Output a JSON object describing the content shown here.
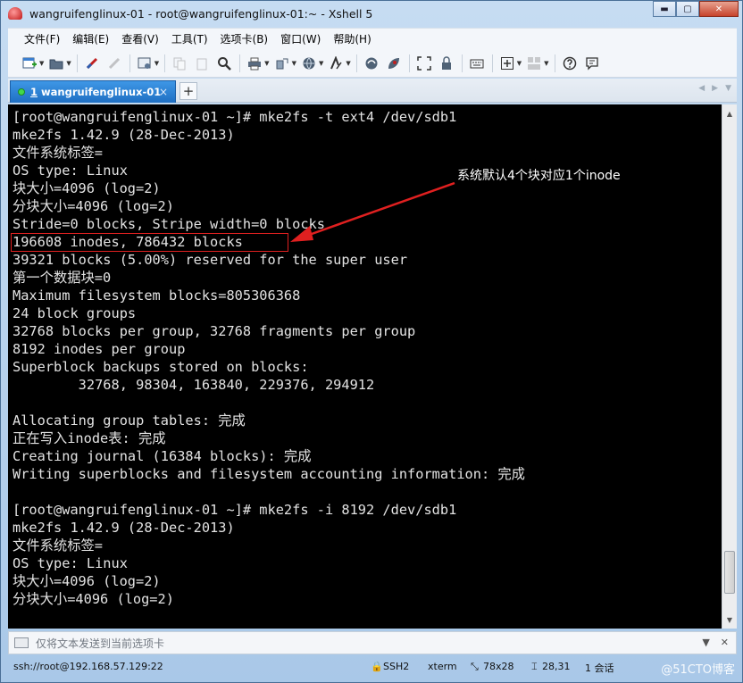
{
  "window": {
    "title": "wangruifenglinux-01 - root@wangruifenglinux-01:~ - Xshell 5",
    "minimize_glyph": "▬",
    "maximize_glyph": "▢",
    "close_glyph": "✕"
  },
  "menu": [
    "文件(F)",
    "编辑(E)",
    "查看(V)",
    "工具(T)",
    "选项卡(B)",
    "窗口(W)",
    "帮助(H)"
  ],
  "tab": {
    "number": "1",
    "label": "wangruifenglinux-01",
    "close_glyph": "×",
    "add_glyph": "+"
  },
  "terminal": {
    "lines": [
      "[root@wangruifenglinux-01 ~]# mke2fs -t ext4 /dev/sdb1",
      "mke2fs 1.42.9 (28-Dec-2013)",
      "文件系统标签=",
      "OS type: Linux",
      "块大小=4096 (log=2)",
      "分块大小=4096 (log=2)",
      "Stride=0 blocks, Stripe width=0 blocks",
      "196608 inodes, 786432 blocks",
      "39321 blocks (5.00%) reserved for the super user",
      "第一个数据块=0",
      "Maximum filesystem blocks=805306368",
      "24 block groups",
      "32768 blocks per group, 32768 fragments per group",
      "8192 inodes per group",
      "Superblock backups stored on blocks:",
      "        32768, 98304, 163840, 229376, 294912",
      "",
      "Allocating group tables: 完成",
      "正在写入inode表: 完成",
      "Creating journal (16384 blocks): 完成",
      "Writing superblocks and filesystem accounting information: 完成",
      "",
      "[root@wangruifenglinux-01 ~]# mke2fs -i 8192 /dev/sdb1",
      "mke2fs 1.42.9 (28-Dec-2013)",
      "文件系统标签=",
      "OS type: Linux",
      "块大小=4096 (log=2)",
      "分块大小=4096 (log=2)"
    ],
    "annotation": "系统默认4个块对应1个inode",
    "annotation_color": "#e02020"
  },
  "sendbar": {
    "placeholder": "仅将文本发送到当前选项卡"
  },
  "status": {
    "connection": "ssh://root@192.168.57.129:22",
    "protocol": "SSH2",
    "terminal_type": "xterm",
    "size": "78x28",
    "cursor": "28,31",
    "sessions": "1 会话"
  },
  "watermark": "@51CTO博客",
  "colors": {
    "terminal_bg": "#000000",
    "terminal_fg": "#e3e3e3",
    "tab_active": "#2a7fd4"
  }
}
